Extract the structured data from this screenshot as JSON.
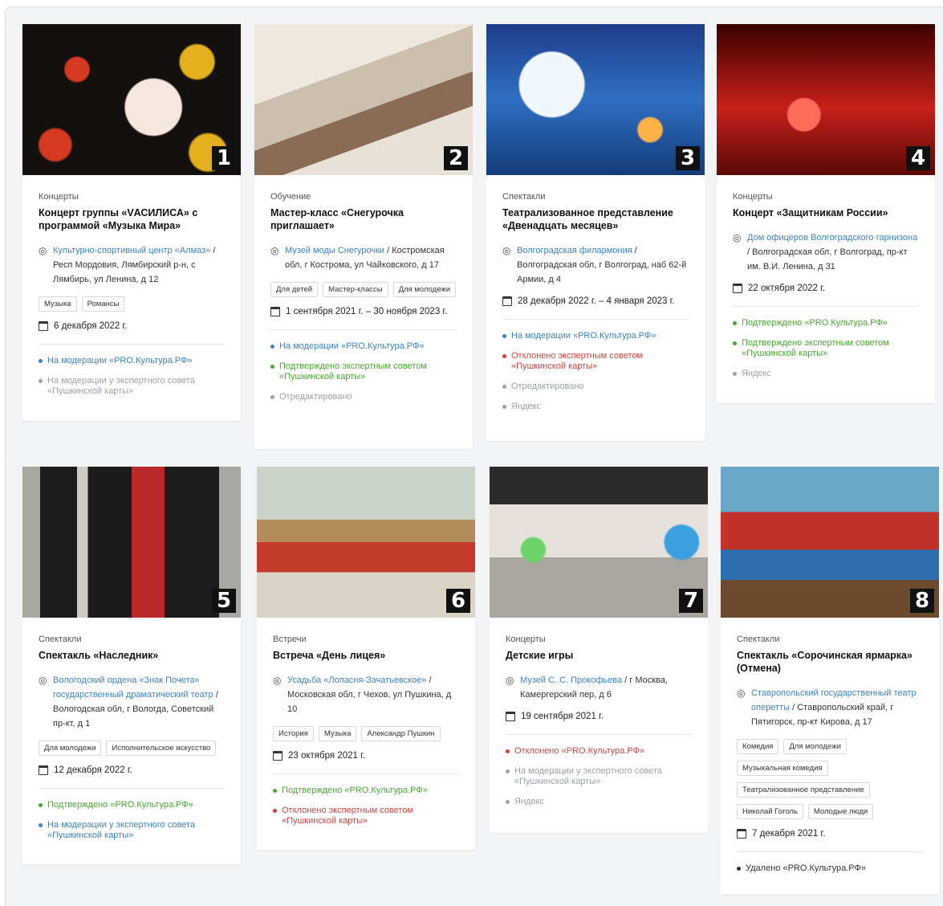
{
  "cards": [
    {
      "number": "1",
      "category": "Концерты",
      "title": "Концерт группы «VАСИЛИСА» с программой «Музыка Мира»",
      "venue": "Культурно-спортивный центр «Алмаз»",
      "address": " / Респ Мордовия, Лямбирский р-н, с Лямбирь, ул Ленина, д 12",
      "tags": [
        "Музыка",
        "Романсы"
      ],
      "date": "6 декабря 2022 г.",
      "statuses": [
        {
          "text": "На модерации «PRO.Культура.РФ»",
          "color": "blue"
        },
        {
          "text": "На модерации у экспертного совета «Пушкинской карты»",
          "color": "gray"
        }
      ]
    },
    {
      "number": "2",
      "category": "Обучение",
      "title": "Мастер-класс «Снегурочка приглашает»",
      "venue": "Музей моды Снегурочки",
      "address": " / Костромская обл, г Кострома, ул Чайковского, д 17",
      "tags": [
        "Для детей",
        "Мастер-классы",
        "Для молодежи"
      ],
      "date": "1 сентября 2021 г. – 30 ноября 2023 г.",
      "statuses": [
        {
          "text": "На модерации «PRO.Культура.РФ»",
          "color": "blue"
        },
        {
          "text": "Подтверждено экспертным советом «Пушкинской карты»",
          "color": "green"
        },
        {
          "text": "Отредактировано",
          "color": "gray"
        }
      ]
    },
    {
      "number": "3",
      "category": "Спектакли",
      "title": "Театрализованное представление «Двенадцать месяцев»",
      "venue": "Волгоградская филармония",
      "address": " / Волгоградская обл, г Волгоград, наб 62-й Армии, д 4",
      "tags": [],
      "date": "28 декабря 2022 г. – 4 января 2023 г.",
      "statuses": [
        {
          "text": "На модерации «PRO.Культура.РФ»",
          "color": "blue"
        },
        {
          "text": "Отклонено экспертным советом «Пушкинской карты»",
          "color": "red"
        },
        {
          "text": "Отредактировано",
          "color": "gray"
        },
        {
          "text": "Яндекс",
          "color": "gray"
        }
      ]
    },
    {
      "number": "4",
      "category": "Концерты",
      "title": "Концерт «Защитникам России»",
      "venue": "Дом офицеров Волгоградского гарнизона",
      "address": " / Волгоградская обл, г Волгоград, пр-кт им. В.И. Ленина, д 31",
      "tags": [],
      "date": "22 октября 2022 г.",
      "statuses": [
        {
          "text": "Подтверждено «PRO.Культура.РФ»",
          "color": "green"
        },
        {
          "text": "Подтверждено экспертным советом «Пушкинской карты»",
          "color": "green"
        },
        {
          "text": "Яндекс",
          "color": "gray"
        }
      ]
    },
    {
      "number": "5",
      "category": "Спектакли",
      "title": "Спектакль «Наследник»",
      "venue": "Вологодский ордена «Знак Почета» государственный драматический театр",
      "address": " / Вологодская обл, г Вологда, Советский пр-кт, д 1",
      "tags": [
        "Для молодежи",
        "Исполнительское искусство"
      ],
      "date": "12 декабря 2022 г.",
      "statuses": [
        {
          "text": "Подтверждено «PRO.Культура.РФ»",
          "color": "green"
        },
        {
          "text": "На модерации у экспертного совета «Пушкинской карты»",
          "color": "blue"
        }
      ]
    },
    {
      "number": "6",
      "category": "Встречи",
      "title": "Встреча «День лицея»",
      "venue": "Усадьба «Лопасня-Зачатьевское»",
      "address": " / Московская обл, г Чехов, ул Пушкина, д 10",
      "tags": [
        "История",
        "Музыка",
        "Александр Пушкин"
      ],
      "date": "23 октября 2021 г.",
      "statuses": [
        {
          "text": "Подтверждено «PRO.Культура.РФ»",
          "color": "green"
        },
        {
          "text": "Отклонено экспертным советом «Пушкинской карты»",
          "color": "red"
        }
      ]
    },
    {
      "number": "7",
      "category": "Концерты",
      "title": "Детские игры",
      "venue": "Музей С. С. Прокофьева",
      "address": " / г Москва, Камергерский пер, д 6",
      "tags": [],
      "date": "19 сентября 2021 г.",
      "statuses": [
        {
          "text": "Отклонено «PRO.Культура.РФ»",
          "color": "red"
        },
        {
          "text": "На модерации у экспертного совета «Пушкинской карты»",
          "color": "gray"
        },
        {
          "text": "Яндекс",
          "color": "gray"
        }
      ]
    },
    {
      "number": "8",
      "category": "Спектакли",
      "title": "Спектакль «Сорочинская ярмарка» (Отмена)",
      "venue": "Ставропольский государственный театр оперетты",
      "address": " / Ставропольский край, г Пятигорск, пр-кт Кирова, д 17",
      "tags": [
        "Комедия",
        "Для молодежи",
        "Музыкальная комедия",
        "Театрализованное представление",
        "Николай Гоголь",
        "Молодые люди"
      ],
      "date": "7 декабря 2021 г.",
      "statuses": [
        {
          "text": "Удалено «PRO.Культура.РФ»",
          "color": "dark"
        }
      ]
    }
  ]
}
